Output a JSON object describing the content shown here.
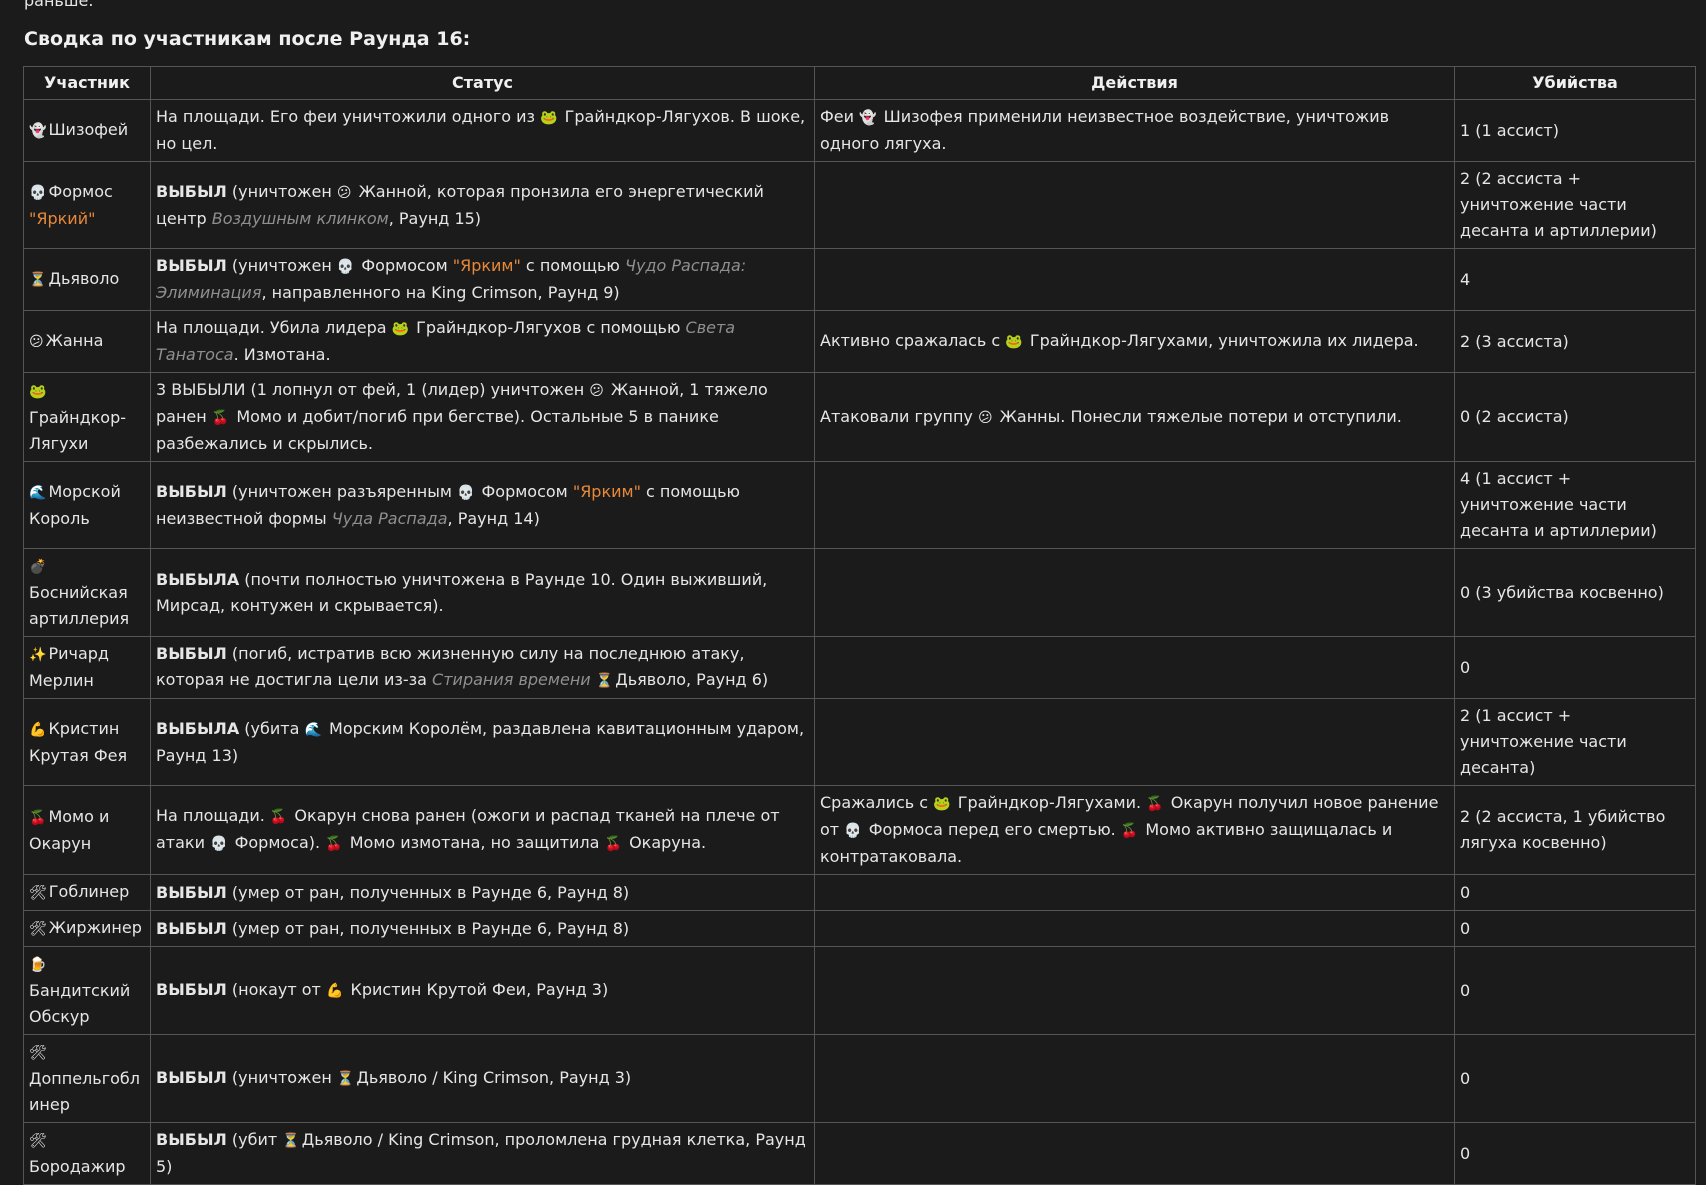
{
  "top_text": "раньше.",
  "heading": "Сводка по участникам после Раунда 16:",
  "table": {
    "headers": [
      "Участник",
      "Статус",
      "Действия",
      "Убийства"
    ],
    "rows": [
      {
        "icon": "👻",
        "name": "Шизофей",
        "status": [
          {
            "t": "На площади. Его феи уничтожили одного из "
          },
          {
            "t": "🐸",
            "icon": true
          },
          {
            "t": " Грайндкор-Лягухов. В шоке, но цел."
          }
        ],
        "actions": [
          {
            "t": "Феи "
          },
          {
            "t": "👻",
            "icon": true
          },
          {
            "t": " Шизофея применили неизвестное воздействие, уничтожив одного лягуха."
          }
        ],
        "kills": "1 (1 ассист)"
      },
      {
        "icon": "💀",
        "name": "Формос",
        "name_extra": "\"Яркий\"",
        "status": [
          {
            "t": "ВЫБЫЛ",
            "b": true
          },
          {
            "t": " (уничтожен "
          },
          {
            "t": "😕",
            "icon": true
          },
          {
            "t": " Жанной, которая пронзила его энергетический центр "
          },
          {
            "t": "Воздушным клинком",
            "it": true
          },
          {
            "t": ", Раунд 15)"
          }
        ],
        "actions": [],
        "kills": "2 (2 ассиста + уничтожение части десанта и артиллерии)"
      },
      {
        "icon": "⏳",
        "name": "Дьяволо",
        "status": [
          {
            "t": "ВЫБЫЛ",
            "b": true
          },
          {
            "t": " (уничтожен "
          },
          {
            "t": "💀",
            "icon": true
          },
          {
            "t": " Формосом "
          },
          {
            "t": "\"Ярким\"",
            "o": true
          },
          {
            "t": " с помощью "
          },
          {
            "t": "Чудо Распада: Элиминация",
            "it": true
          },
          {
            "t": ", направленного на King Crimson, Раунд 9)"
          }
        ],
        "actions": [],
        "kills": "4"
      },
      {
        "icon": "😕",
        "name": "Жанна",
        "status": [
          {
            "t": "На площади. Убила лидера "
          },
          {
            "t": "🐸",
            "icon": true
          },
          {
            "t": " Грайндкор-Лягухов с помощью "
          },
          {
            "t": "Света Танатоса",
            "it": true
          },
          {
            "t": ". Измотана."
          }
        ],
        "actions": [
          {
            "t": "Активно сражалась с "
          },
          {
            "t": "🐸",
            "icon": true
          },
          {
            "t": " Грайндкор-Лягухами, уничтожила их лидера."
          }
        ],
        "kills": "2 (3 ассиста)"
      },
      {
        "icon": "🐸",
        "name": "Грайндкор-Лягухи",
        "icon_block": true,
        "status": [
          {
            "t": "3 ВЫБЫЛИ (1 лопнул от фей, 1 (лидер) уничтожен "
          },
          {
            "t": "😕",
            "icon": true
          },
          {
            "t": " Жанной, 1 тяжело ранен "
          },
          {
            "t": "🍒",
            "icon": true
          },
          {
            "t": " Момо и добит/погиб при бегстве). Остальные 5 в панике разбежались и скрылись."
          }
        ],
        "actions": [
          {
            "t": "Атаковали группу "
          },
          {
            "t": "😕",
            "icon": true
          },
          {
            "t": " Жанны. Понесли тяжелые потери и отступили."
          }
        ],
        "kills": "0 (2 ассиста)"
      },
      {
        "icon": "🌊",
        "name": "Морской Король",
        "status": [
          {
            "t": "ВЫБЫЛ",
            "b": true
          },
          {
            "t": " (уничтожен разъяренным "
          },
          {
            "t": "💀",
            "icon": true
          },
          {
            "t": " Формосом "
          },
          {
            "t": "\"Ярким\"",
            "o": true
          },
          {
            "t": " с помощью неизвестной формы "
          },
          {
            "t": "Чуда Распада",
            "it": true
          },
          {
            "t": ", Раунд 14)"
          }
        ],
        "actions": [],
        "kills": "4 (1 ассист + уничтожение части десанта и артиллерии)"
      },
      {
        "icon": "💣",
        "name": "Боснийская артиллерия",
        "icon_block": true,
        "status": [
          {
            "t": "ВЫБЫЛА",
            "b": true
          },
          {
            "t": " (почти полностью уничтожена в Раунде 10. Один выживший, Мирсад, контужен и скрывается)."
          }
        ],
        "actions": [],
        "kills": "0 (3 убийства косвенно)"
      },
      {
        "icon": "✨",
        "name": "Ричард Мерлин",
        "status": [
          {
            "t": "ВЫБЫЛ",
            "b": true
          },
          {
            "t": " (погиб, истратив всю жизненную силу на последнюю атаку, которая не достигла цели из-за "
          },
          {
            "t": "Стирания времени",
            "it": true
          },
          {
            "t": " "
          },
          {
            "t": "⏳",
            "icon": true
          },
          {
            "t": "Дьяволо, Раунд 6)"
          }
        ],
        "actions": [],
        "kills": "0"
      },
      {
        "icon": "💪",
        "name": "Кристин Крутая Фея",
        "status": [
          {
            "t": "ВЫБЫЛА",
            "b": true
          },
          {
            "t": " (убита "
          },
          {
            "t": "🌊",
            "icon": true
          },
          {
            "t": " Морским Королём, раздавлена кавитационным ударом, Раунд 13)"
          }
        ],
        "actions": [],
        "kills": "2 (1 ассист + уничтожение части десанта)"
      },
      {
        "icon": "🍒",
        "name": "Момо и Окарун",
        "status": [
          {
            "t": "На площади. "
          },
          {
            "t": "🍒",
            "icon": true
          },
          {
            "t": " Окарун снова ранен (ожоги и распад тканей на плече от атаки "
          },
          {
            "t": "💀",
            "icon": true
          },
          {
            "t": " Формоса). "
          },
          {
            "t": "🍒",
            "icon": true
          },
          {
            "t": " Момо измотана, но защитила "
          },
          {
            "t": "🍒",
            "icon": true
          },
          {
            "t": " Окаруна."
          }
        ],
        "actions": [
          {
            "t": "Сражались с "
          },
          {
            "t": "🐸",
            "icon": true
          },
          {
            "t": " Грайндкор-Лягухами. "
          },
          {
            "t": "🍒",
            "icon": true
          },
          {
            "t": " Окарун получил новое ранение от "
          },
          {
            "t": "💀",
            "icon": true
          },
          {
            "t": " Формоса перед его смертью. "
          },
          {
            "t": "🍒",
            "icon": true
          },
          {
            "t": " Момо активно защищалась и контратаковала."
          }
        ],
        "kills": "2 (2 ассиста, 1 убийство лягуха косвенно)"
      },
      {
        "icon": "🛠",
        "name": "Гоблинер",
        "status": [
          {
            "t": "ВЫБЫЛ",
            "b": true
          },
          {
            "t": " (умер от ран, полученных в Раунде 6, Раунд 8)"
          }
        ],
        "actions": [],
        "kills": "0"
      },
      {
        "icon": "🛠",
        "name": "Жиржинер",
        "status": [
          {
            "t": "ВЫБЫЛ",
            "b": true
          },
          {
            "t": " (умер от ран, полученных в Раунде 6, Раунд 8)"
          }
        ],
        "actions": [],
        "kills": "0"
      },
      {
        "icon": "🍺",
        "name": "Бандитский Обскур",
        "icon_block": true,
        "status": [
          {
            "t": "ВЫБЫЛ",
            "b": true
          },
          {
            "t": " (нокаут от "
          },
          {
            "t": "💪",
            "icon": true
          },
          {
            "t": " Кристин Крутой Феи, Раунд 3)"
          }
        ],
        "actions": [],
        "kills": "0"
      },
      {
        "icon": "🛠",
        "name": "Доппельгоблинер",
        "icon_block": true,
        "status": [
          {
            "t": "ВЫБЫЛ",
            "b": true
          },
          {
            "t": " (уничтожен "
          },
          {
            "t": "⏳",
            "icon": true
          },
          {
            "t": "Дьяволо / King Crimson, Раунд 3)"
          }
        ],
        "actions": [],
        "kills": "0"
      },
      {
        "icon": "🛠",
        "name": "Бородажир",
        "icon_block": true,
        "status": [
          {
            "t": "ВЫБЫЛ",
            "b": true
          },
          {
            "t": " (убит "
          },
          {
            "t": "⏳",
            "icon": true
          },
          {
            "t": "Дьяволо / King Crimson, проломлена грудная клетка, Раунд 5)"
          }
        ],
        "actions": [],
        "kills": "0"
      }
    ]
  }
}
